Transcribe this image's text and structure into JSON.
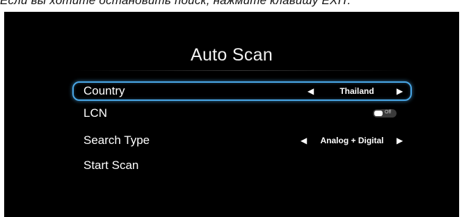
{
  "caption": "Если вы хотите остановить поиск, нажмите клавишу EXIT.",
  "screen": {
    "title": "Auto Scan"
  },
  "menu": {
    "country": {
      "label": "Country",
      "value": "Thailand",
      "prev_icon": "left-arrow",
      "next_icon": "right-arrow"
    },
    "lcn": {
      "label": "LCN",
      "toggle_text": "Off",
      "toggle_state": false
    },
    "search_type": {
      "label": "Search Type",
      "value": "Analog + Digital",
      "prev_icon": "left-arrow",
      "next_icon": "right-arrow"
    },
    "start_scan": {
      "label": "Start Scan"
    }
  },
  "colors": {
    "background": "#000000",
    "focus_ring": "#4aa8e8",
    "text": "#ffffff"
  }
}
